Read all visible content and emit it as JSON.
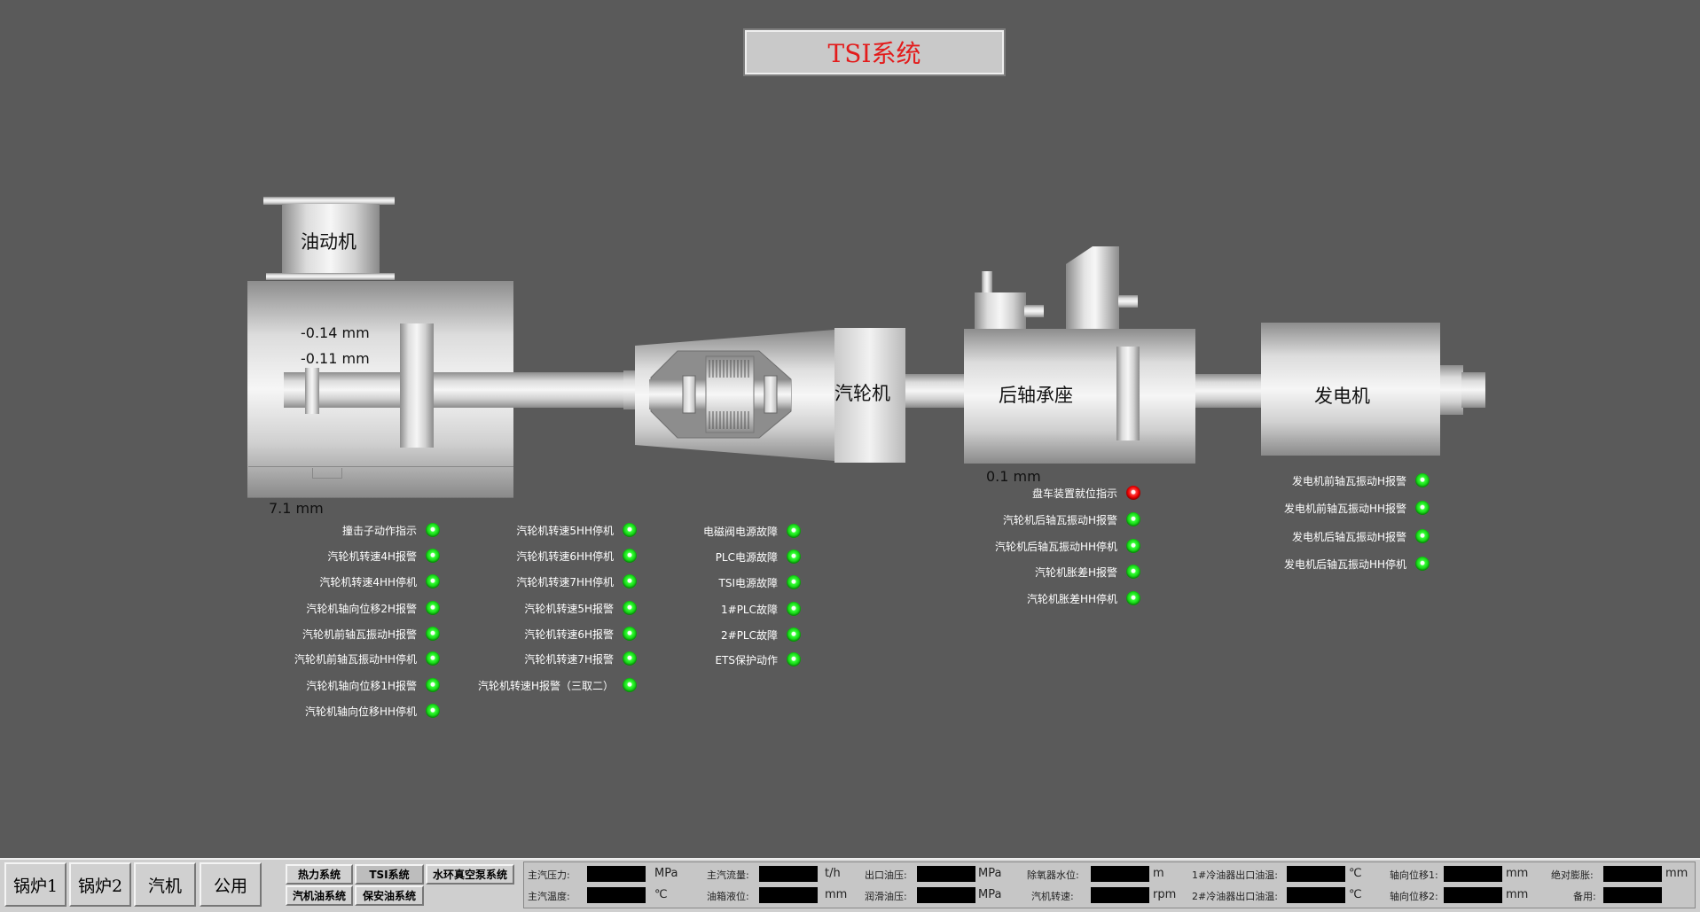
{
  "title": "TSI系统",
  "machines": {
    "oil_motor": "油动机",
    "turbine": "汽轮机",
    "rear_bearing": "后轴承座",
    "generator": "发电机"
  },
  "measurements": {
    "m1": "-0.14 mm",
    "m2": "-0.11 mm",
    "m3": "7.1 mm",
    "m4": "0.1 mm"
  },
  "indicators": {
    "col1": [
      "撞击子动作指示",
      "汽轮机转速4H报警",
      "汽轮机转速4HH停机",
      "汽轮机轴向位移2H报警",
      "汽轮机前轴瓦振动H报警",
      "汽轮机前轴瓦振动HH停机",
      "汽轮机轴向位移1H报警",
      "汽轮机轴向位移HH停机"
    ],
    "col2": [
      "汽轮机转速5HH停机",
      "汽轮机转速6HH停机",
      "汽轮机转速7HH停机",
      "汽轮机转速5H报警",
      "汽轮机转速6H报警",
      "汽轮机转速7H报警",
      "汽轮机转速H报警（三取二）"
    ],
    "col3": [
      "电磁阀电源故障",
      "PLC电源故障",
      "TSI电源故障",
      "1#PLC故障",
      "2#PLC故障",
      "ETS保护动作"
    ],
    "col4": [
      "盘车装置就位指示",
      "汽轮机后轴瓦振动H报警",
      "汽轮机后轴瓦振动HH停机",
      "汽轮机胀差H报警",
      "汽轮机胀差HH停机"
    ],
    "col4_states": [
      "red",
      "green",
      "green",
      "green",
      "green"
    ],
    "col5": [
      "发电机前轴瓦振动H报警",
      "发电机前轴瓦振动HH报警",
      "发电机后轴瓦振动H报警",
      "发电机后轴瓦振动HH停机"
    ]
  },
  "nav": {
    "boiler1": "锅炉1",
    "boiler2": "锅炉2",
    "turbine": "汽机",
    "common": "公用"
  },
  "subnav": {
    "thermal": "热力系统",
    "tsi": "TSI系统",
    "vacuum": "水环真空泵系统",
    "turbine_oil": "汽机油系统",
    "safety_oil": "保安油系统"
  },
  "status": {
    "main_steam_pressure": {
      "label": "主汽压力:",
      "unit": "MPa"
    },
    "main_steam_temp": {
      "label": "主汽温度:",
      "unit": "℃"
    },
    "main_steam_flow": {
      "label": "主汽流量:",
      "unit": "t/h"
    },
    "oil_tank_level": {
      "label": "油箱液位:",
      "unit": "mm"
    },
    "outlet_oil_pressure": {
      "label": "出口油压:",
      "unit": "MPa"
    },
    "lube_oil_pressure": {
      "label": "润滑油压:",
      "unit": "MPa"
    },
    "deaerator_level": {
      "label": "除氧器水位:",
      "unit": "m"
    },
    "turbine_speed": {
      "label": "汽机转速:",
      "unit": "rpm"
    },
    "cooler1_temp": {
      "label": "1#冷油器出口油温:",
      "unit": "℃"
    },
    "cooler2_temp": {
      "label": "2#冷油器出口油温:",
      "unit": "℃"
    },
    "axial_disp1": {
      "label": "轴向位移1:",
      "unit": "mm"
    },
    "axial_disp2": {
      "label": "轴向位移2:",
      "unit": "mm"
    },
    "abs_expansion": {
      "label": "绝对膨胀:",
      "unit": "mm"
    },
    "spare": {
      "label": "备用:",
      "unit": ""
    }
  }
}
